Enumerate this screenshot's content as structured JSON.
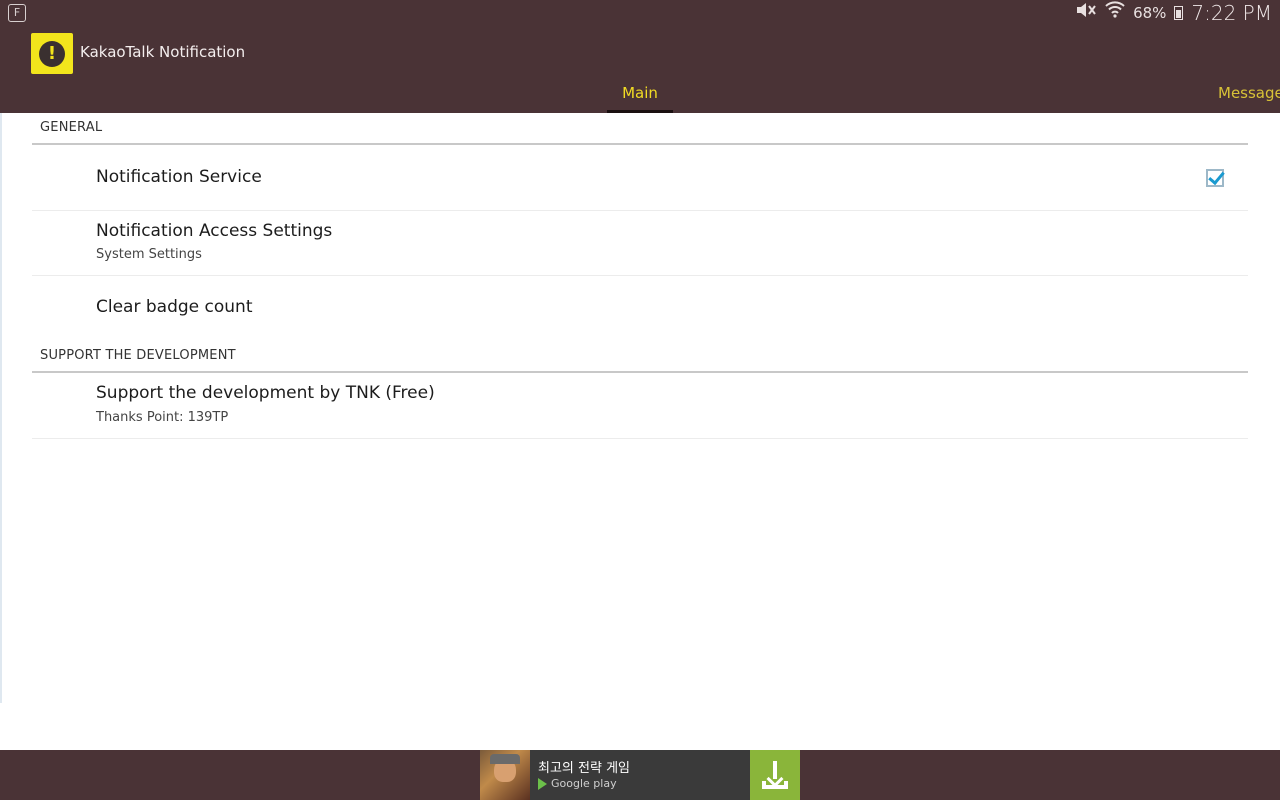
{
  "status_bar": {
    "left_icon": "flipboard-icon",
    "left_glyph": "F",
    "battery_percent": "68%",
    "time": "7:22 PM",
    "icons": [
      "mute-icon",
      "wifi-icon",
      "battery-icon"
    ]
  },
  "action_bar": {
    "app_icon": "warning-icon",
    "app_icon_glyph": "!",
    "title": "KakaoTalk Notification"
  },
  "tabs": [
    {
      "label": "Main",
      "selected": true
    },
    {
      "label": "Message",
      "selected": false
    }
  ],
  "categories": [
    {
      "header": "GENERAL",
      "items": [
        {
          "title": "Notification Service",
          "summary": "",
          "checked": true
        },
        {
          "title": "Notification Access Settings",
          "summary": "System Settings"
        },
        {
          "title": "Clear badge count",
          "summary": ""
        }
      ]
    },
    {
      "header": "SUPPORT THE DEVELOPMENT",
      "items": [
        {
          "title": "Support the development by TNK (Free)",
          "summary": "Thanks Point: 139TP"
        }
      ]
    }
  ],
  "ad": {
    "text": "최고의 전략 게임",
    "store": "Google play",
    "download_icon": "download-icon"
  },
  "colors": {
    "bar_background": "#4a3336",
    "tab_active": "#f2dc24",
    "app_icon_bg": "#f2e51c",
    "checkbox_check": "#1a9ad0",
    "download_bg": "#8ab53a"
  }
}
